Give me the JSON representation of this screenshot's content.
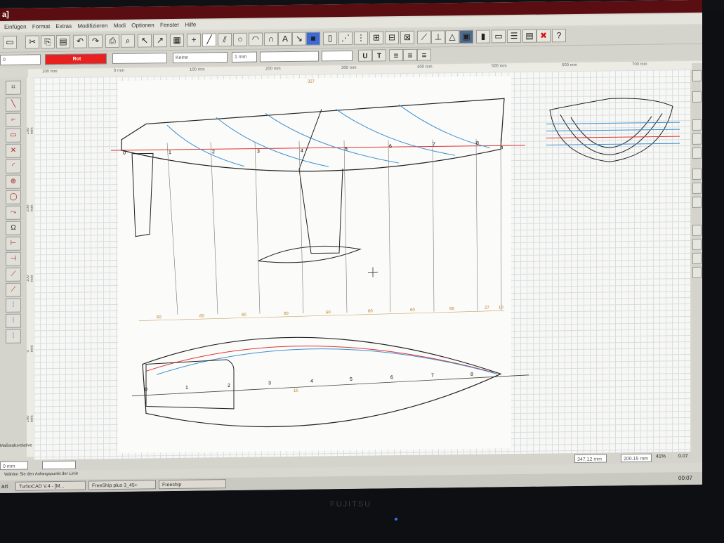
{
  "app": {
    "title": "a]",
    "brand": "FUJITSU"
  },
  "menu": [
    "Einfügen",
    "Format",
    "Extras",
    "Modifizieren",
    "Modi",
    "Optionen",
    "Fenster",
    "Hilfe"
  ],
  "props": {
    "layer": "0",
    "color": "Rot",
    "linestyle": "",
    "fill": "Keine",
    "width": "1 mm",
    "text_u": "U",
    "text_t": "T"
  },
  "ruler_labels": [
    "100 mm",
    "0 mm",
    "100 mm",
    "200 mm",
    "300 mm",
    "400 mm",
    "500 mm",
    "600 mm",
    "700 mm"
  ],
  "vruler_labels": [
    "100 mm",
    "200 mm",
    "100 mm",
    "0 mm",
    "100 mm"
  ],
  "drawing": {
    "top_mark": "327",
    "stations": [
      "0",
      "1",
      "2",
      "3",
      "4",
      "5",
      "6",
      "7",
      "8",
      "9"
    ],
    "plan_stations": [
      "0",
      "1",
      "2",
      "3",
      "4",
      "5",
      "6",
      "7",
      "8"
    ],
    "dims": [
      "60",
      "60",
      "60",
      "60",
      "60",
      "60",
      "60",
      "60",
      "27",
      "10"
    ],
    "center_mark": "15"
  },
  "status": {
    "layer_panel": "Maßstabsrelative",
    "unit": "0 mm",
    "coord_x": "347.12 mm",
    "coord_y": "200.15 mm",
    "zoom": "41%",
    "val": "0.07",
    "prompt": "Wählen Sie den Anfangspunkt der Linie"
  },
  "taskbar": {
    "start": "art",
    "items": [
      "TurboCAD V.4 - [M...",
      "FreeShip plus 3_45+",
      "Freeship"
    ],
    "clock": "00:07"
  }
}
